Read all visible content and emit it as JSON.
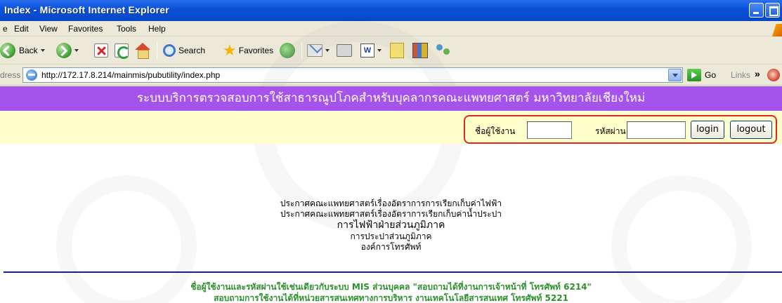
{
  "window": {
    "title": "Index - Microsoft Internet Explorer"
  },
  "menu": {
    "items": [
      "e",
      "Edit",
      "View",
      "Favorites",
      "Tools",
      "Help"
    ]
  },
  "toolbar": {
    "back_label": "Back",
    "search_label": "Search",
    "favorites_label": "Favorites"
  },
  "address": {
    "label": "dress",
    "url": "http://172.17.8.214/mainmis/pubutility/index.php",
    "go_label": "Go",
    "links_label": "Links",
    "links_chevron": "»"
  },
  "page": {
    "banner": "ระบบบริการตรวจสอบการใช้สาธารณูปโภคสำหรับบุคลากรคณะแพทยศาสตร์ มหาวิทยาลัยเชียงใหม่",
    "login": {
      "username_label": "ชื่อผู้ใช้งาน",
      "username_value": "",
      "password_label": "รหัสผ่าน",
      "password_value": "",
      "login_button": "login",
      "logout_button": "logout"
    },
    "announcements": [
      "ประกาศคณะแพทยศาสตร์เรื่องอัตราการการเรียกเก็บค่าไฟฟ้า",
      "ประกาศคณะแพทยศาสตร์เรื่องอัตราการเรียกเก็บค่าน้ำประปา",
      "การไฟฟ้าฝ่ายส่วนภูมิภาค",
      "การประปาส่วนภูมิภาค",
      "องค์การโทรศัพท์"
    ],
    "footer": [
      "ชื่อผู้ใช้งานและรหัสผ่านใช้เช่นเดียวกับระบบ MIS ส่วนบุคคล \"สอบถามได้ที่งานการเจ้าหน้าที่ โทรศัพท์ 6214\"",
      "สอบถามการใช้งานได้ที่หน่วยสารสนเทศทางการบริหาร งานเทคโนโลยีสารสนเทศ โทรศัพท์ 5221"
    ]
  }
}
